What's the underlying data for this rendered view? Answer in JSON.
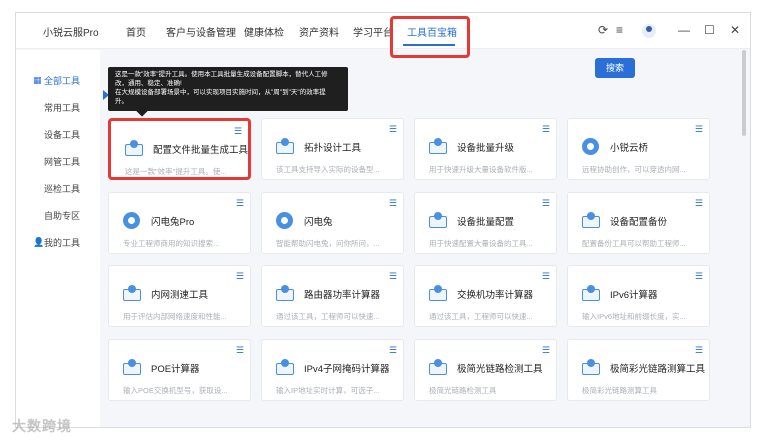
{
  "app": {
    "title": "小锐云服Pro"
  },
  "nav": [
    {
      "label": "首页",
      "active": false
    },
    {
      "label": "客户与设备管理",
      "active": false
    },
    {
      "label": "健康体检",
      "active": false
    },
    {
      "label": "资产资料",
      "active": false
    },
    {
      "label": "学习平台",
      "active": false
    },
    {
      "label": "工具百宝箱",
      "active": true
    }
  ],
  "window_controls": {
    "help": "⟳",
    "menu": "≡",
    "minimize": "—",
    "maximize": "☐",
    "close": "✕"
  },
  "sidebar": [
    {
      "label": "全部工具",
      "active": true
    },
    {
      "label": "常用工具",
      "active": false
    },
    {
      "label": "设备工具",
      "active": false
    },
    {
      "label": "网管工具",
      "active": false
    },
    {
      "label": "巡检工具",
      "active": false
    },
    {
      "label": "自助专区",
      "active": false
    },
    {
      "label": "我的工具",
      "active": false
    }
  ],
  "search": {
    "button": "搜索"
  },
  "tooltip": {
    "line1": "这是一款\"效率\"提升工具。使用本工具批量生成设备配置脚本，替代人工修",
    "line2": "改，通用、稳定、准确!",
    "line3": "在大规模设备部署场景中，可以实现项目实施时间，从\"周\"到\"天\"的效率提",
    "line4": "升。"
  },
  "cards": [
    {
      "title": "配置文件批量生成工具",
      "desc": "这是一款\"效率\"提升工具。使..."
    },
    {
      "title": "拓扑设计工具",
      "desc": "该工具支持导入实际的设备型..."
    },
    {
      "title": "设备批量升级",
      "desc": "用于快速升级大量设备软件版..."
    },
    {
      "title": "小锐云桥",
      "desc": "远程协助创作，可以穿透内网..."
    },
    {
      "title": "闪电兔Pro",
      "desc": "专业工程师商用的知识搜索..."
    },
    {
      "title": "闪电兔",
      "desc": "智能帮助闪电兔，问你所问，..."
    },
    {
      "title": "设备批量配置",
      "desc": "用于快速配置大量设备的工具..."
    },
    {
      "title": "设备配置备份",
      "desc": "配置备份工具可以帮助工程师..."
    },
    {
      "title": "内网测速工具",
      "desc": "用于评估内部网络速度和性能..."
    },
    {
      "title": "路由器功率计算器",
      "desc": "通过该工具，工程师可以快速..."
    },
    {
      "title": "交换机功率计算器",
      "desc": "通过该工具，工程师可以快速..."
    },
    {
      "title": "IPv6计算器",
      "desc": "输入IPv6地址和前缀长度，实..."
    },
    {
      "title": "POE计算器",
      "desc": "输入POE交换机型号，获取设..."
    },
    {
      "title": "IPv4子网掩码计算器",
      "desc": "输入IP地址实时计算，可选子..."
    },
    {
      "title": "极简光链路检测工具",
      "desc": "极简光链路检测工具"
    },
    {
      "title": "极简彩光链路测算工具",
      "desc": "极简彩光链路测算工具"
    }
  ],
  "watermark": "大数跨境"
}
